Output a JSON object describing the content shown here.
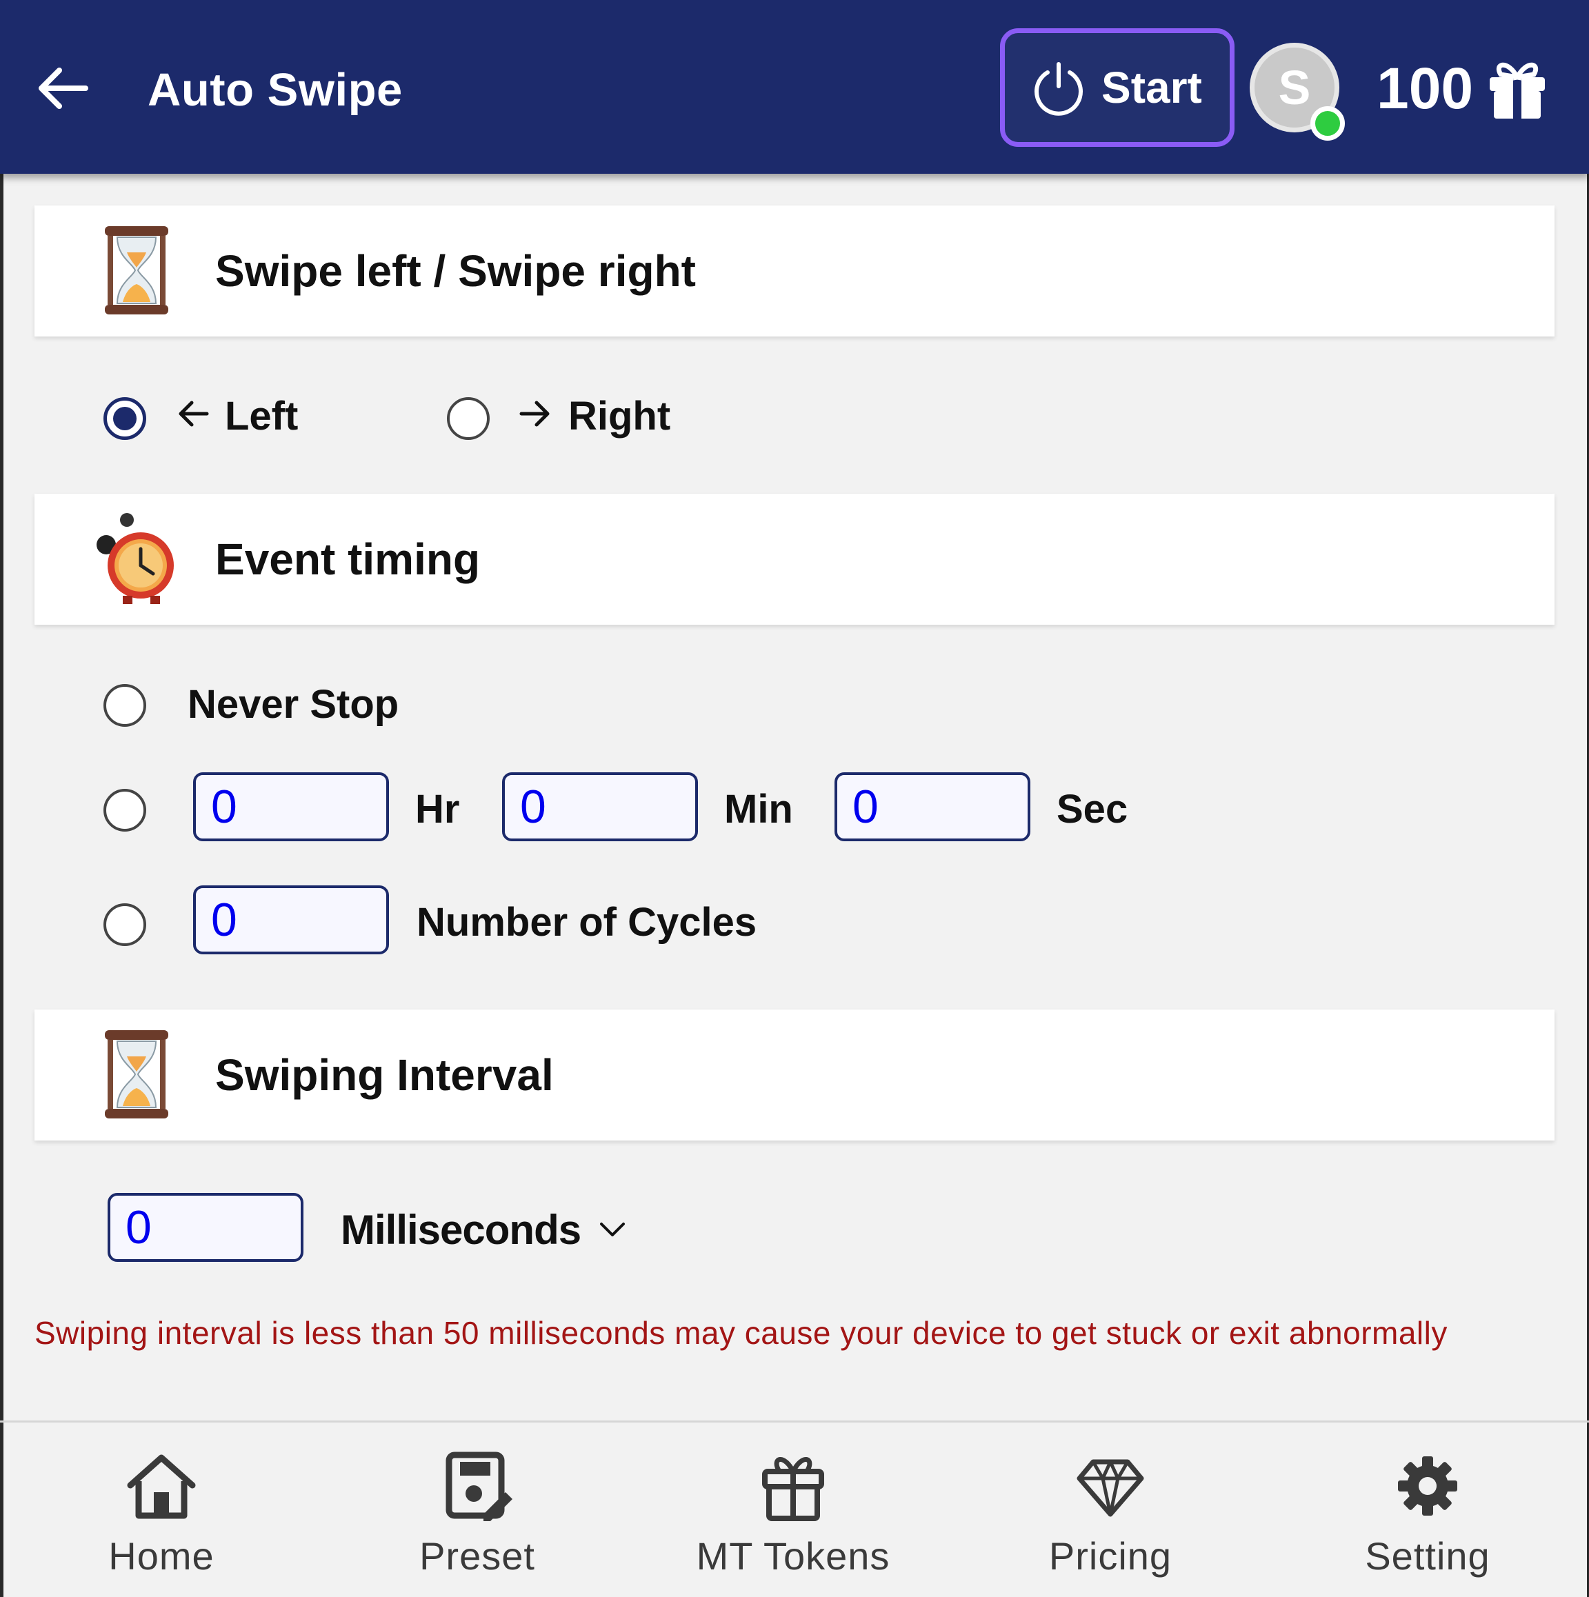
{
  "header": {
    "title": "Auto Swipe",
    "start_label": "Start",
    "avatar_initial": "S",
    "token_count": "100"
  },
  "sections": {
    "direction": {
      "title": "Swipe left / Swipe right",
      "left_label": "Left",
      "right_label": "Right",
      "selected": "Left"
    },
    "timing": {
      "title": "Event timing",
      "never_stop_label": "Never Stop",
      "hr_value": "0",
      "hr_label": "Hr",
      "min_value": "0",
      "min_label": "Min",
      "sec_value": "0",
      "sec_label": "Sec",
      "cycles_value": "0",
      "cycles_label": "Number of Cycles"
    },
    "interval": {
      "title": "Swiping Interval",
      "value": "0",
      "unit_selected": "Milliseconds",
      "warning": "Swiping interval is less than 50 milliseconds may cause your device to get stuck or exit abnormally"
    }
  },
  "bottom_nav": {
    "items": [
      {
        "label": "Home",
        "icon": "home-icon"
      },
      {
        "label": "Preset",
        "icon": "preset-icon"
      },
      {
        "label": "MT Tokens",
        "icon": "gift-icon"
      },
      {
        "label": "Pricing",
        "icon": "diamond-icon"
      },
      {
        "label": "Setting",
        "icon": "gear-icon"
      }
    ]
  },
  "colors": {
    "header_bg": "#1c2a6b",
    "start_border": "#8a5cf5",
    "input_text": "#0000ee",
    "warning_text": "#a31515",
    "online": "#2ecc40"
  }
}
